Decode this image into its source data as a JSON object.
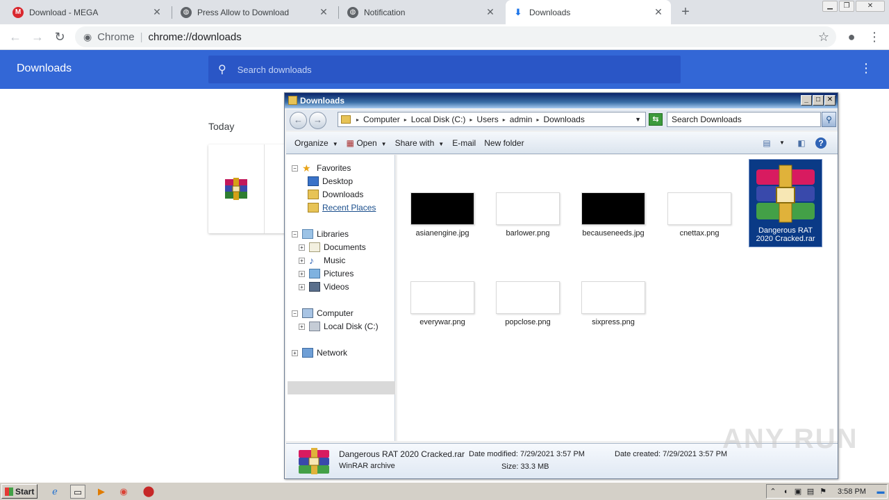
{
  "tabs": [
    {
      "title": "Download - MEGA",
      "icon": "mega-icon"
    },
    {
      "title": "Press Allow to Download",
      "icon": "globe-icon"
    },
    {
      "title": "Notification",
      "icon": "globe-icon"
    },
    {
      "title": "Downloads",
      "icon": "download-icon"
    }
  ],
  "omnibox": {
    "site": "Chrome",
    "url": "chrome://downloads"
  },
  "downloads_page": {
    "title": "Downloads",
    "search_placeholder": "Search downloads",
    "date_group": "Today"
  },
  "explorer": {
    "title": "Downloads",
    "breadcrumb": [
      "Computer",
      "Local Disk (C:)",
      "Users",
      "admin",
      "Downloads"
    ],
    "search_placeholder": "Search Downloads",
    "commands": {
      "organize": "Organize",
      "open": "Open",
      "share": "Share with",
      "email": "E-mail",
      "new_folder": "New folder"
    },
    "nav": {
      "favorites": "Favorites",
      "desktop": "Desktop",
      "downloads": "Downloads",
      "recent": "Recent Places",
      "libraries": "Libraries",
      "documents": "Documents",
      "music": "Music",
      "pictures": "Pictures",
      "videos": "Videos",
      "computer": "Computer",
      "localdisk": "Local Disk (C:)",
      "network": "Network"
    },
    "files": [
      {
        "name": "asianengine.jpg",
        "style": "black"
      },
      {
        "name": "barlower.png",
        "style": "white"
      },
      {
        "name": "becauseneeds.jpg",
        "style": "black"
      },
      {
        "name": "cnettax.png",
        "style": "white"
      },
      {
        "name": "everywar.png",
        "style": "white"
      },
      {
        "name": "popclose.png",
        "style": "white"
      },
      {
        "name": "sixpress.png",
        "style": "white"
      }
    ],
    "selected_file": {
      "name_line1": "Dangerous RAT",
      "name_line2": "2020 Cracked.rar"
    },
    "details": {
      "name": "Dangerous RAT 2020 Cracked.rar",
      "type": "WinRAR archive",
      "modified_label": "Date modified:",
      "modified": "7/29/2021 3:57 PM",
      "created_label": "Date created:",
      "created": "7/29/2021 3:57 PM",
      "size_label": "Size:",
      "size": "33.3 MB"
    }
  },
  "watermark": "ANY RUN",
  "taskbar": {
    "start": "Start",
    "clock": "3:58 PM"
  }
}
